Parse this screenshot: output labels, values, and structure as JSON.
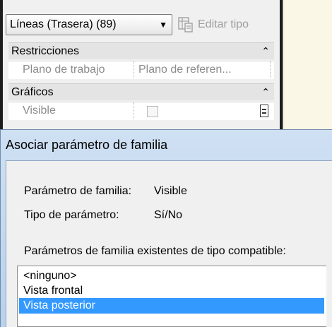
{
  "palette": {
    "type_selector": "Líneas (Trasera) (89)",
    "edit_type_label": "Editar tipo",
    "sections": [
      {
        "label": "Restricciones"
      },
      {
        "label": "Gráficos"
      }
    ],
    "rows": [
      {
        "name": "Plano de trabajo",
        "value": "Plano de referen..."
      },
      {
        "name": "Visible",
        "value": ""
      }
    ]
  },
  "dialog": {
    "title": "Asociar parámetro de familia",
    "family_param_label": "Parámetro de familia:",
    "family_param_value": "Visible",
    "param_type_label": "Tipo de parámetro:",
    "param_type_value": "Sí/No",
    "existing_label": "Parámetros de familia existentes de tipo compatible:",
    "list_items": [
      "<ninguno>",
      "Vista frontal",
      "Vista posterior"
    ],
    "selected_index": 2
  },
  "colors": {
    "selection": "#3399ff",
    "title_bar": "#c4d8ef",
    "panel": "#f0f0f0"
  }
}
